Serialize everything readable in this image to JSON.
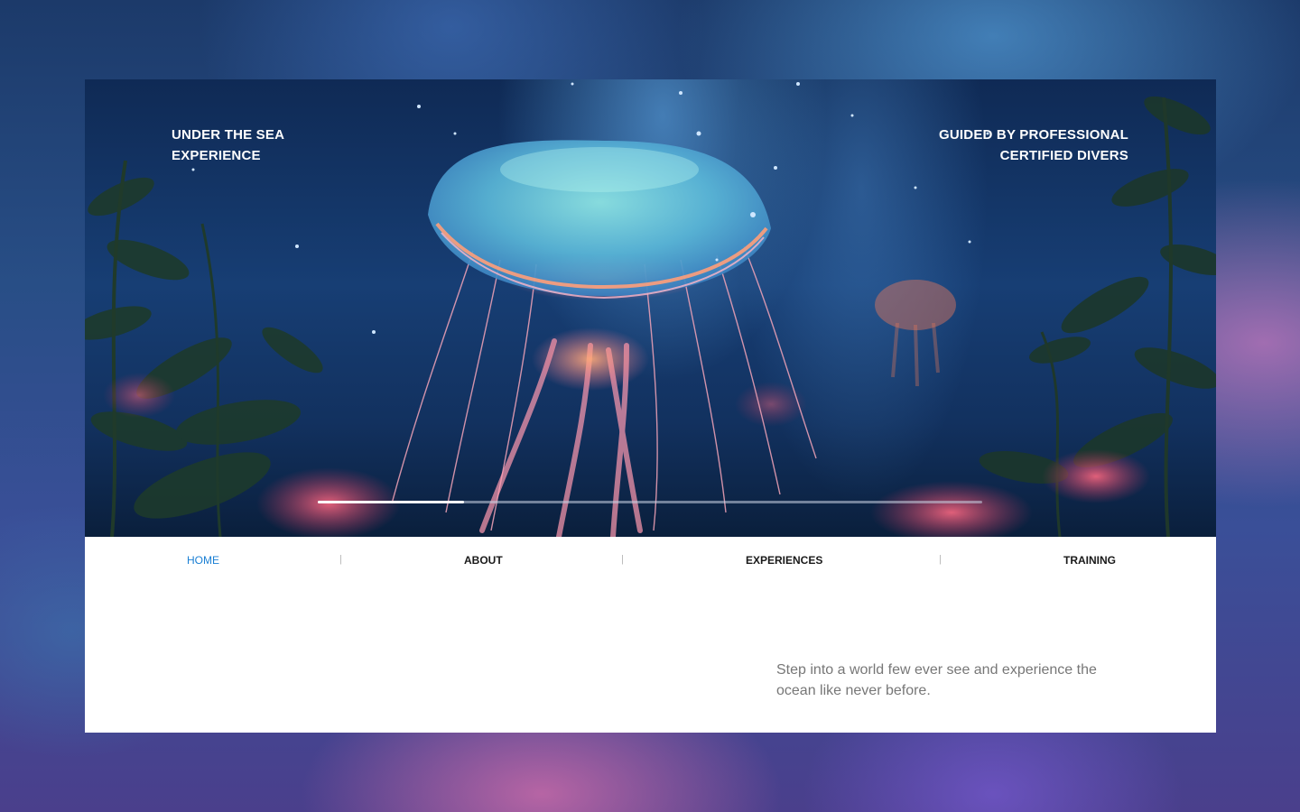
{
  "hero": {
    "left_heading": [
      "UNDER THE SEA",
      "EXPERIENCE"
    ],
    "right_heading": [
      "GUIDED BY PROFESSIONAL",
      "CERTIFIED DIVERS"
    ],
    "slide_progress": 0.22
  },
  "nav": {
    "items": [
      {
        "label": "HOME",
        "active": true
      },
      {
        "label": "ABOUT",
        "active": false
      },
      {
        "label": "EXPERIENCES",
        "active": false
      },
      {
        "label": "TRAINING",
        "active": false
      }
    ],
    "separator": "|"
  },
  "content": {
    "tagline": "Step into a world few ever see and experience the ocean like never before."
  },
  "colors": {
    "accent": "#1a7fd4",
    "text": "#1a1a1a",
    "muted": "#777777"
  }
}
